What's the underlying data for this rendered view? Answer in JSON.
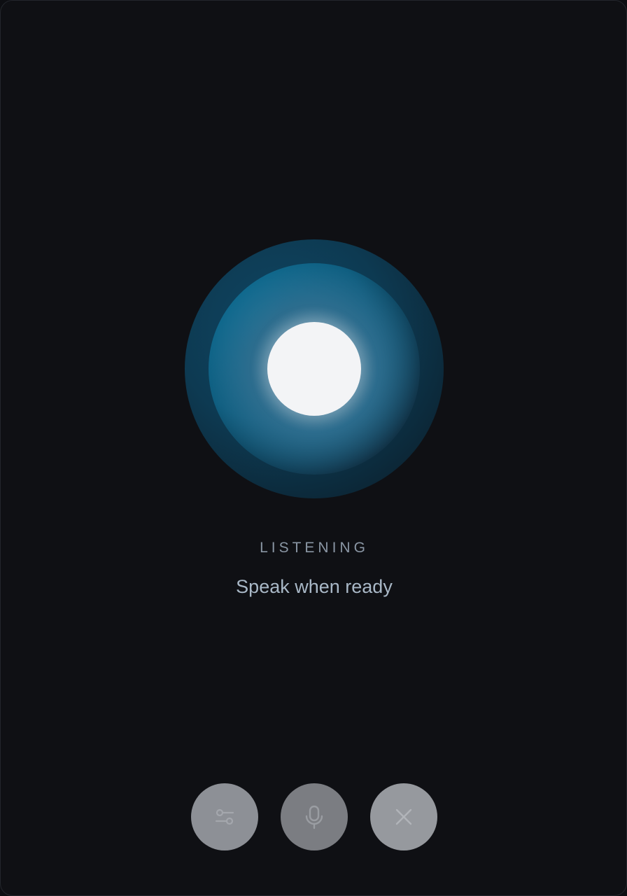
{
  "voice": {
    "status": "LISTENING",
    "prompt": "Speak when ready"
  },
  "orb": {
    "state": "listening",
    "colors": {
      "core": "#f3f4f6",
      "ring": "#11739a",
      "outer": "#0d3a52"
    }
  },
  "controls": {
    "settings": {
      "icon": "sliders-icon"
    },
    "mic": {
      "icon": "microphone-icon"
    },
    "close": {
      "icon": "close-icon"
    }
  }
}
